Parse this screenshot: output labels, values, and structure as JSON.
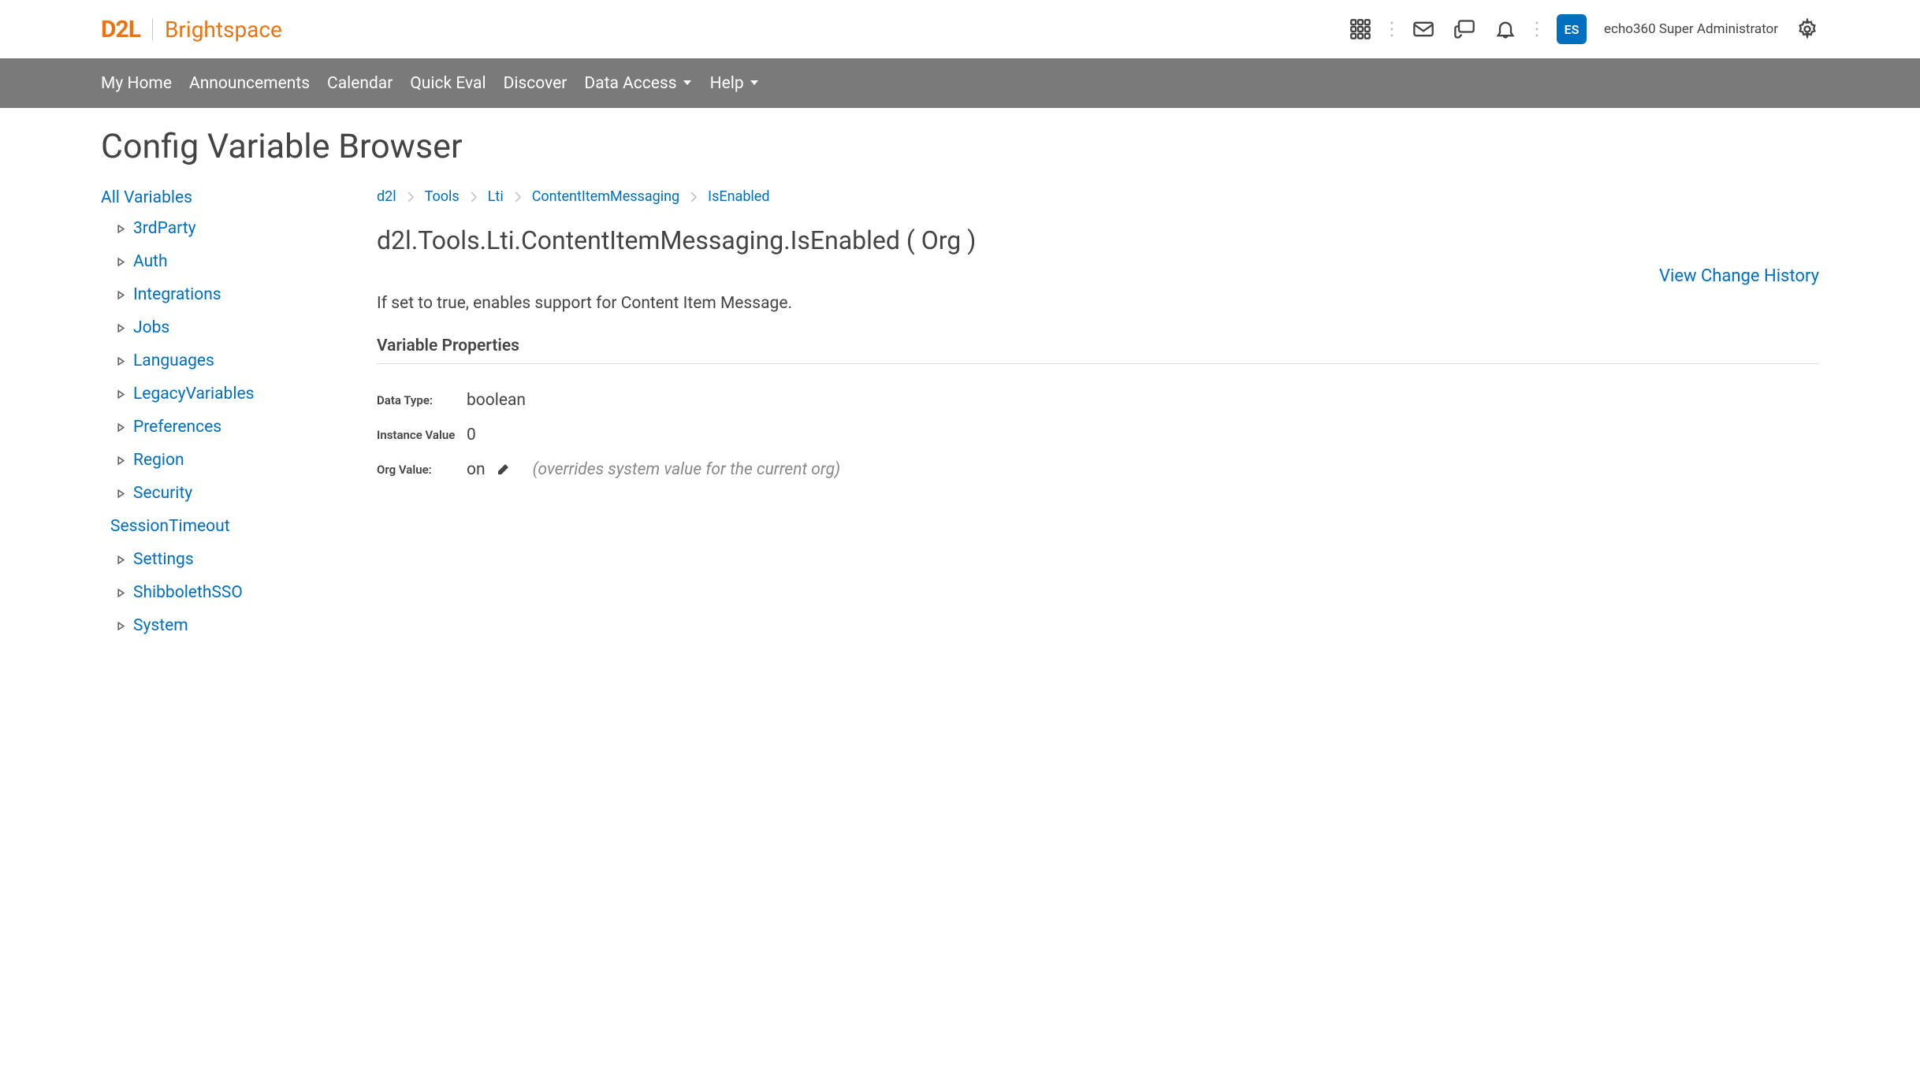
{
  "brand": {
    "short": "D2L",
    "name": "Brightspace"
  },
  "user": {
    "initials": "ES",
    "name": "echo360 Super Administrator"
  },
  "nav": {
    "items": [
      {
        "label": "My Home",
        "dropdown": false
      },
      {
        "label": "Announcements",
        "dropdown": false
      },
      {
        "label": "Calendar",
        "dropdown": false
      },
      {
        "label": "Quick Eval",
        "dropdown": false
      },
      {
        "label": "Discover",
        "dropdown": false
      },
      {
        "label": "Data Access",
        "dropdown": true
      },
      {
        "label": "Help",
        "dropdown": true
      }
    ]
  },
  "page": {
    "title": "Config Variable Browser"
  },
  "sidebar": {
    "root": "All Variables",
    "items": [
      {
        "label": "3rdParty",
        "expandable": true
      },
      {
        "label": "Auth",
        "expandable": true
      },
      {
        "label": "Integrations",
        "expandable": true
      },
      {
        "label": "Jobs",
        "expandable": true
      },
      {
        "label": "Languages",
        "expandable": true
      },
      {
        "label": "LegacyVariables",
        "expandable": true
      },
      {
        "label": "Preferences",
        "expandable": true
      },
      {
        "label": "Region",
        "expandable": true
      },
      {
        "label": "Security",
        "expandable": true
      },
      {
        "label": "SessionTimeout",
        "expandable": false
      },
      {
        "label": "Settings",
        "expandable": true
      },
      {
        "label": "ShibbolethSSO",
        "expandable": true
      },
      {
        "label": "System",
        "expandable": true
      }
    ]
  },
  "breadcrumb": {
    "items": [
      "d2l",
      "Tools",
      "Lti",
      "ContentItemMessaging",
      "IsEnabled"
    ]
  },
  "variable": {
    "title": "d2l.Tools.Lti.ContentItemMessaging.IsEnabled ( Org )",
    "history_link": "View Change History",
    "description": "If set to true, enables support for Content Item Message.",
    "section_heading": "Variable Properties",
    "props": {
      "data_type_label": "Data Type:",
      "data_type_value": "boolean",
      "instance_value_label": "Instance Value",
      "instance_value_value": "0",
      "org_value_label": "Org Value:",
      "org_value_value": "on",
      "org_value_note": "(overrides system value for the current org)"
    }
  }
}
